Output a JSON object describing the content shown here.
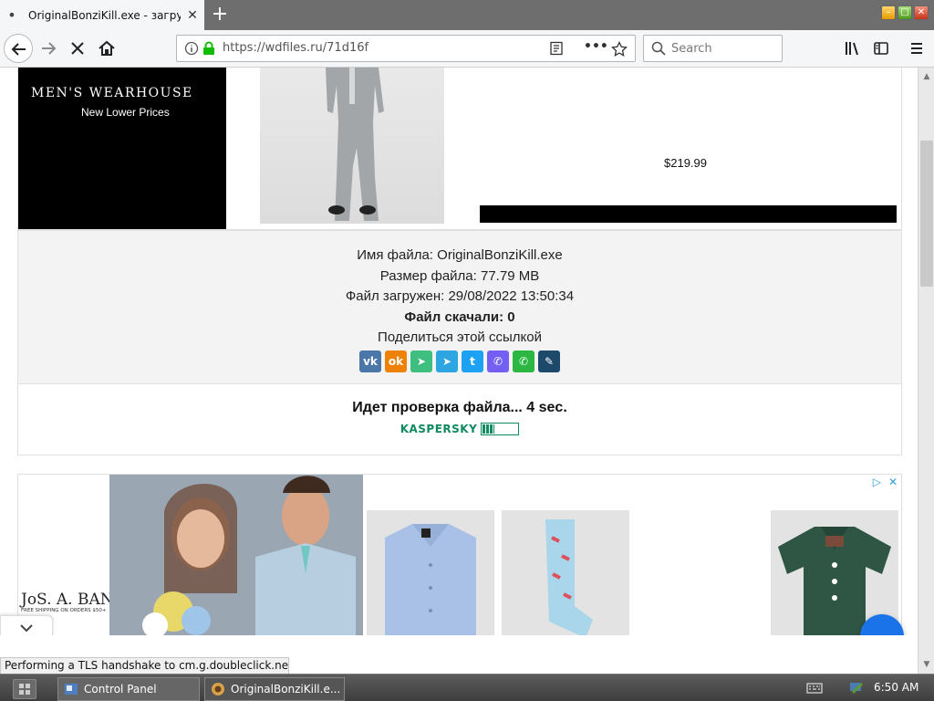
{
  "browser": {
    "tab_title": "OriginalBonziKill.exe - загру",
    "url": "https://wdfiles.ru/71d16f",
    "search_placeholder": "Search"
  },
  "top_ad": {
    "brand": "MEN'S WEARHOUSE",
    "tagline": "New Lower Prices",
    "price": "$219.99"
  },
  "file_info": {
    "name_label": "Имя файла:",
    "name_value": "OriginalBonziKill.exe",
    "size_label": "Размер файла:",
    "size_value": "77.79 MB",
    "uploaded_label": "Файл загружен:",
    "uploaded_value": "29/08/2022 13:50:34",
    "downloads_label": "Файл скачали:",
    "downloads_value": "0",
    "share_label": "Поделиться этой ссылкой",
    "share_buttons": [
      {
        "name": "vk",
        "glyph": "vk",
        "color": "#4a76a8"
      },
      {
        "name": "odnoklassniki",
        "glyph": "ok",
        "color": "#ee8208"
      },
      {
        "name": "share",
        "glyph": "➤",
        "color": "#3fbf7f"
      },
      {
        "name": "telegram",
        "glyph": "➤",
        "color": "#2ca5e0"
      },
      {
        "name": "twitter",
        "glyph": "t",
        "color": "#1da1f2"
      },
      {
        "name": "viber",
        "glyph": "✆",
        "color": "#7360f2"
      },
      {
        "name": "whatsapp",
        "glyph": "✆",
        "color": "#2cb742"
      },
      {
        "name": "livejournal",
        "glyph": "✎",
        "color": "#1d4a6b"
      }
    ]
  },
  "check": {
    "text": "Идет проверка файла... 4 sec.",
    "brand": "KASPERSKY",
    "progress": 0.35
  },
  "bottom_ad": {
    "brand": "JoS. A. BANK",
    "shipping": "FREE SHIPPING ON ORDERS $50+",
    "adchoices_glyph": "▷",
    "close_glyph": "✕"
  },
  "status_text": "Performing a TLS handshake to cm.g.doubleclick.net...",
  "taskbar": {
    "items": [
      {
        "label": "Control Panel"
      },
      {
        "label": "OriginalBonziKill.e..."
      }
    ],
    "time": "6:50 AM"
  }
}
